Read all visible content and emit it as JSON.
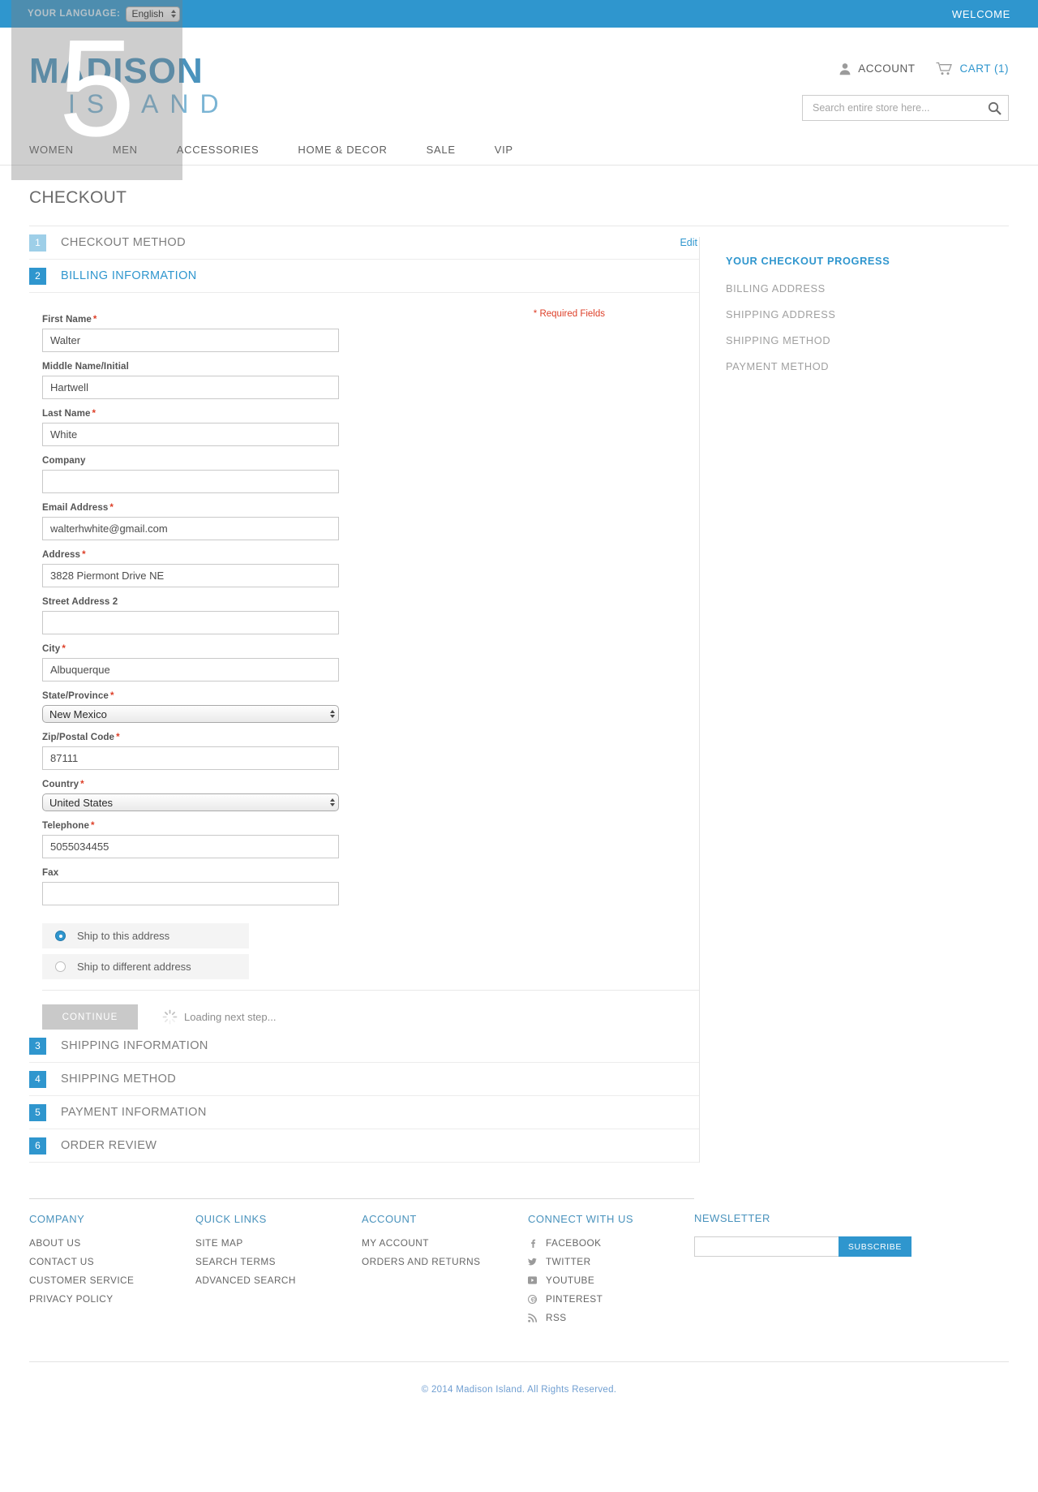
{
  "topbar": {
    "language_label": "YOUR LANGUAGE:",
    "language_value": "English",
    "welcome": "WELCOME"
  },
  "header": {
    "logo_line1": "MADISON",
    "logo_line2": "ISLAND",
    "account_label": "ACCOUNT",
    "cart_label": "CART (1)",
    "search_placeholder": "Search entire store here...",
    "search_value": ""
  },
  "nav": {
    "items": [
      {
        "label": "WOMEN"
      },
      {
        "label": "MEN"
      },
      {
        "label": "ACCESSORIES"
      },
      {
        "label": "HOME & DECOR"
      },
      {
        "label": "SALE"
      },
      {
        "label": "VIP"
      }
    ]
  },
  "page": {
    "title": "CHECKOUT"
  },
  "steps": [
    {
      "num": "1",
      "title": "CHECKOUT METHOD",
      "state": "done",
      "edit": "Edit"
    },
    {
      "num": "2",
      "title": "BILLING INFORMATION",
      "state": "active",
      "edit": ""
    },
    {
      "num": "3",
      "title": "SHIPPING INFORMATION",
      "state": "pending",
      "edit": ""
    },
    {
      "num": "4",
      "title": "SHIPPING METHOD",
      "state": "pending",
      "edit": ""
    },
    {
      "num": "5",
      "title": "PAYMENT INFORMATION",
      "state": "pending",
      "edit": ""
    },
    {
      "num": "6",
      "title": "ORDER REVIEW",
      "state": "pending",
      "edit": ""
    }
  ],
  "billing": {
    "required_note": "* Required Fields",
    "fields": {
      "first_name": {
        "label": "First Name",
        "required": true,
        "value": "Walter"
      },
      "middle_name": {
        "label": "Middle Name/Initial",
        "required": false,
        "value": "Hartwell"
      },
      "last_name": {
        "label": "Last Name",
        "required": true,
        "value": "White"
      },
      "company": {
        "label": "Company",
        "required": false,
        "value": ""
      },
      "email": {
        "label": "Email Address",
        "required": true,
        "value": "walterhwhite@gmail.com"
      },
      "address": {
        "label": "Address",
        "required": true,
        "value": "3828 Piermont Drive NE"
      },
      "street2": {
        "label": "Street Address 2",
        "required": false,
        "value": ""
      },
      "city": {
        "label": "City",
        "required": true,
        "value": "Albuquerque"
      },
      "state": {
        "label": "State/Province",
        "required": true,
        "value": "New Mexico"
      },
      "zip": {
        "label": "Zip/Postal Code",
        "required": true,
        "value": "87111"
      },
      "country": {
        "label": "Country",
        "required": true,
        "value": "United States"
      },
      "telephone": {
        "label": "Telephone",
        "required": true,
        "value": "5055034455"
      },
      "fax": {
        "label": "Fax",
        "required": false,
        "value": ""
      }
    },
    "ship_same_label": "Ship to this address",
    "ship_different_label": "Ship to different address",
    "ship_selected": "same",
    "continue_label": "CONTINUE",
    "continue_disabled": true,
    "loading_text": "Loading next step..."
  },
  "progress": {
    "heading": "YOUR CHECKOUT PROGRESS",
    "items": [
      {
        "label": "BILLING ADDRESS"
      },
      {
        "label": "SHIPPING ADDRESS"
      },
      {
        "label": "SHIPPING METHOD"
      },
      {
        "label": "PAYMENT METHOD"
      }
    ]
  },
  "footer": {
    "columns": [
      {
        "heading": "COMPANY",
        "links": [
          "ABOUT US",
          "CONTACT US",
          "CUSTOMER SERVICE",
          "PRIVACY POLICY"
        ]
      },
      {
        "heading": "QUICK LINKS",
        "links": [
          "SITE MAP",
          "SEARCH TERMS",
          "ADVANCED SEARCH"
        ]
      },
      {
        "heading": "ACCOUNT",
        "links": [
          "MY ACCOUNT",
          "ORDERS AND RETURNS"
        ]
      }
    ],
    "social": {
      "heading": "CONNECT WITH US",
      "links": [
        {
          "label": "FACEBOOK",
          "icon": "facebook-icon"
        },
        {
          "label": "TWITTER",
          "icon": "twitter-icon"
        },
        {
          "label": "YOUTUBE",
          "icon": "youtube-icon"
        },
        {
          "label": "PINTEREST",
          "icon": "pinterest-icon"
        },
        {
          "label": "RSS",
          "icon": "rss-icon"
        }
      ]
    },
    "newsletter": {
      "heading": "NEWSLETTER",
      "value": "",
      "button": "SUBSCRIBE"
    },
    "copyright": "© 2014 Madison Island. All Rights Reserved."
  },
  "overlay": {
    "number": "5"
  },
  "colors": {
    "accent": "#2f96ce",
    "accent_light": "#9ecfe8",
    "logo": "#4a93bd",
    "required_red": "#dd3f28",
    "text": "#636363"
  }
}
